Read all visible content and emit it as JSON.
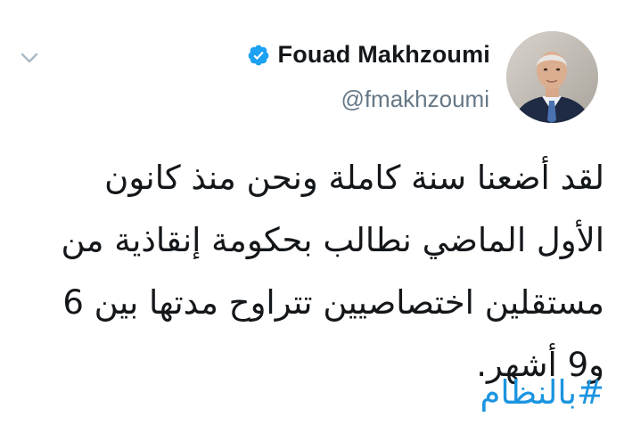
{
  "tweet": {
    "author": {
      "display_name": "Fouad Makhzoumi",
      "handle": "@fmakhzoumi",
      "verified": true
    },
    "text": "لقد أضعنا سنة كاملة ونحن منذ كانون الأول الماضي نطالب بحكومة إنقاذية من مستقلين اختصاصيين تتراوح مدتها بين 6 و9 أشهر.",
    "hashtag": "#بالنظام"
  },
  "icons": {
    "menu": "chevron-down-icon",
    "verified": "verified-badge-icon"
  },
  "colors": {
    "verified_blue": "#1da1f2",
    "hashtag_blue": "#1b95e0",
    "text": "#14171a",
    "secondary": "#657786",
    "chevron": "#aab8c2"
  }
}
